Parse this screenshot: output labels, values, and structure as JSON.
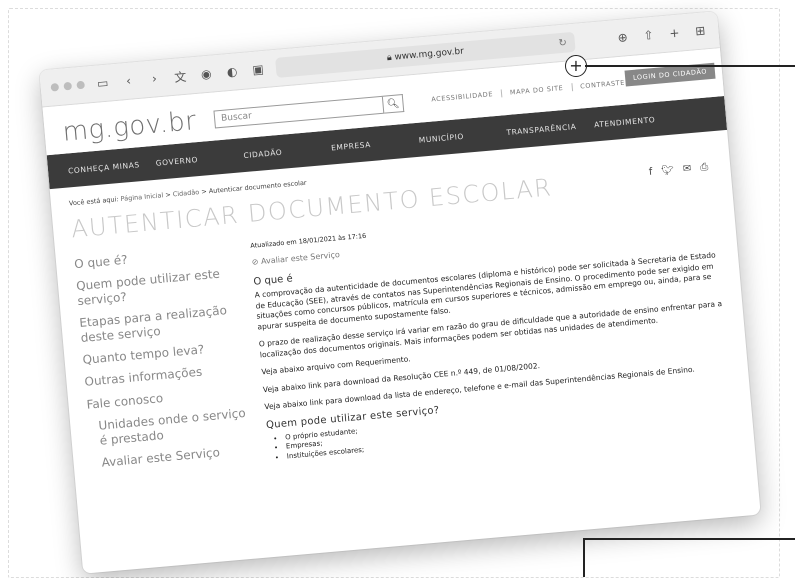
{
  "browser": {
    "url": "www.mg.gov.br"
  },
  "site": {
    "logo": "mg.gov.br",
    "search_placeholder": "Buscar",
    "util_links": [
      "ACESSIBILIDADE",
      "MAPA DO SITE",
      "CONTRASTE"
    ],
    "login": "LOGIN DO CIDADÃO",
    "nav": [
      "CONHEÇA MINAS",
      "GOVERNO",
      "CIDADÃO",
      "EMPRESA",
      "MUNICÍPIO",
      "TRANSPARÊNCIA",
      "ATENDIMENTO"
    ]
  },
  "breadcrumb": {
    "prefix": "Você está aqui:",
    "items": [
      "Página Inicial",
      "Cidadão",
      "Autenticar documento escolar"
    ],
    "sep": ">"
  },
  "page": {
    "title": "AUTENTICAR DOCUMENTO ESCOLAR"
  },
  "sidebar": {
    "items": [
      "O que é?",
      "Quem pode utilizar este serviço?",
      "Etapas para a realização deste serviço",
      "Quanto tempo leva?",
      "Outras informações",
      "Fale conosco",
      "Unidades onde o serviço é prestado",
      "Avaliar este Serviço"
    ]
  },
  "main": {
    "updated": "Atualizado em 18/01/2021 às 17:16",
    "rate": "Avaliar este Serviço",
    "section1_title": "O que é",
    "p1": "A comprovação da autenticidade de documentos escolares (diploma e histórico) pode ser solicitada à Secretaria de Estado de Educação (SEE), através de contatos nas Superintendências Regionais de Ensino. O procedimento pode ser exigido em situações como concursos públicos, matrícula em cursos superiores e técnicos, admissão em emprego ou, ainda, para se apurar suspeita de documento supostamente falso.",
    "p2": "O prazo de realização desse serviço irá variar em razão do grau de dificuldade que a autoridade de ensino enfrentar para a localização dos documentos originais. Mais informações podem ser obtidas nas unidades de atendimento.",
    "p3": "Veja abaixo arquivo com Requerimento.",
    "p4": "Veja abaixo link para download da Resolução CEE n.º 449, de 01/08/2002.",
    "p5": "Veja abaixo link para download da lista de endereço, telefone e e-mail das Superintendências Regionais de Ensino.",
    "section2_title": "Quem pode utilizar este serviço?",
    "list": [
      "O próprio estudante;",
      "Empresas;",
      "Instituições escolares;"
    ]
  }
}
